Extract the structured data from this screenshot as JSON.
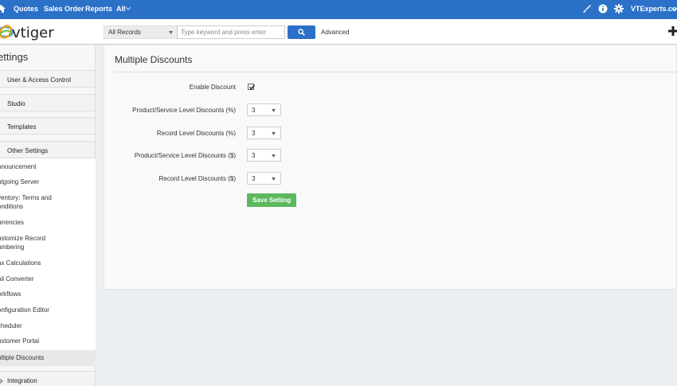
{
  "topbar": {
    "nav": [
      "Quotes",
      "Sales Order",
      "Reports",
      "All"
    ],
    "user": "VTExperts.com",
    "colors": {
      "bg": "#2c71c8"
    }
  },
  "header": {
    "logo_text": "vtiger",
    "search_scope": "All Records",
    "search_placeholder": "Type keyword and press enter",
    "advanced_label": "Advanced"
  },
  "sidebar": {
    "title": "ettings",
    "blocks": [
      "User & Access Control",
      "Studio",
      "Templates",
      "Other Settings"
    ],
    "items": [
      "nnouncement",
      "utgoing Server",
      "ventory: Terms and\nonditions",
      "urrencies",
      "ustomize Record\numbering",
      "ax Calculations",
      "ail Converter",
      "orkflows",
      "onfiguration Editor",
      "cheduler",
      "ustomer Portal"
    ],
    "active_item": "ultiple Discounts",
    "integration_label": "Integration"
  },
  "main": {
    "title": "Multiple Discounts",
    "enable_label": "Enable Discount",
    "enable_checked": true,
    "fields": [
      {
        "label": "Product/Service Level Discounts (%)",
        "value": "3"
      },
      {
        "label": "Record Level Discounts (%)",
        "value": "3"
      },
      {
        "label": "Product/Service Level Discounts ($)",
        "value": "3"
      },
      {
        "label": "Record Level Discounts ($)",
        "value": "3"
      }
    ],
    "save_label": "Save Setting",
    "colors": {
      "save": "#5cb85c"
    }
  },
  "icons": [
    "home-icon",
    "chevron-down-icon",
    "brush-icon",
    "info-icon",
    "gear-icon",
    "search-icon",
    "plus-icon",
    "checkmark-icon",
    "integration-icon"
  ]
}
